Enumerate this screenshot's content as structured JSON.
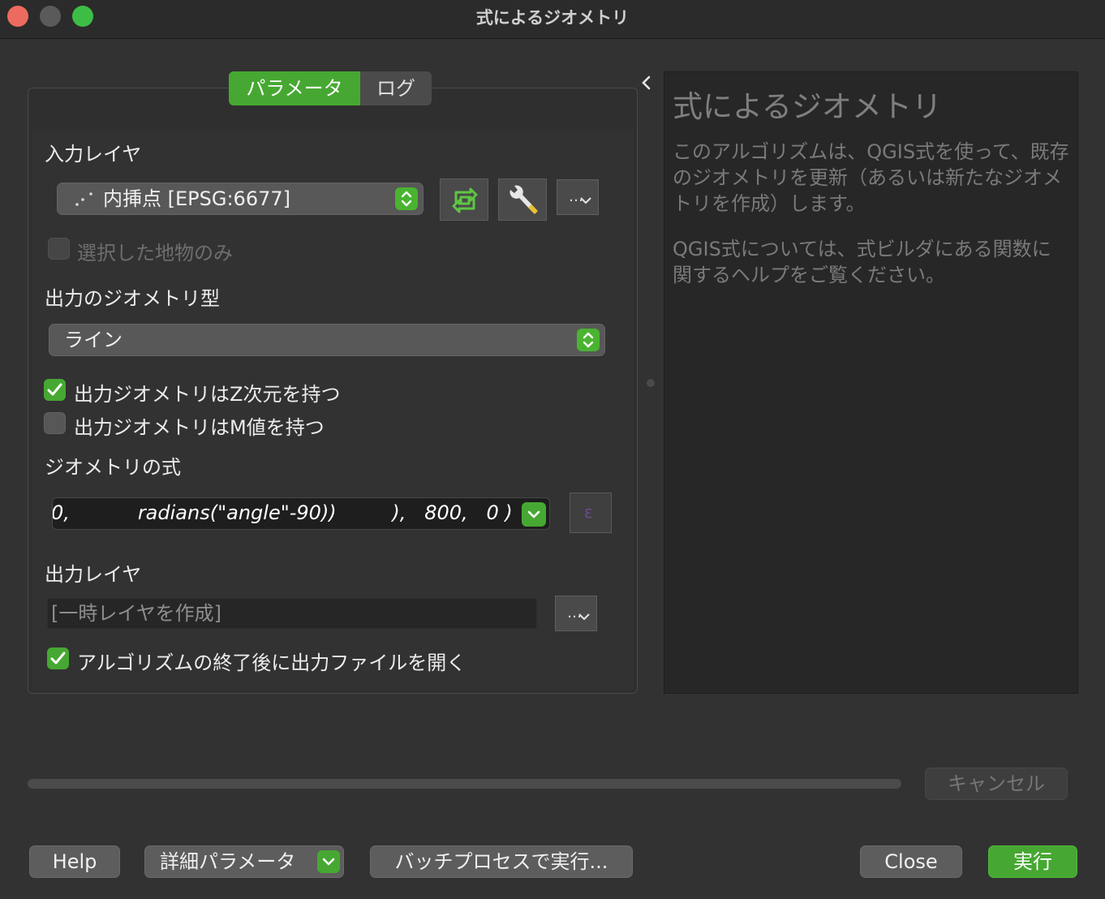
{
  "window": {
    "title": "式によるジオメトリ"
  },
  "tabs": [
    {
      "label": "パラメータ",
      "active": true
    },
    {
      "label": "ログ",
      "active": false
    }
  ],
  "params": {
    "input_layer_label": "入力レイヤ",
    "input_layer_value": "内挿点 [EPSG:6677]",
    "selected_only_label": "選択した地物のみ",
    "selected_only_checked": false,
    "output_geom_type_label": "出力のジオメトリ型",
    "output_geom_type_value": "ライン",
    "has_z_label": "出力ジオメトリはZ次元を持つ",
    "has_z_checked": true,
    "has_m_label": "出力ジオメトリはM値を持つ",
    "has_m_checked": false,
    "expression_label": "ジオメトリの式",
    "expression_value": "0,           radians(\"angle\"-90))         ),   800,   0 )",
    "output_layer_label": "出力レイヤ",
    "output_layer_placeholder": "[一時レイヤを作成]",
    "open_output_label": "アルゴリズムの終了後に出力ファイルを開く",
    "open_output_checked": true,
    "dots_label": "…"
  },
  "help": {
    "title": "式によるジオメトリ",
    "paragraph1": "このアルゴリズムは、QGIS式を使って、既存のジオメトリを更新（あるいは新たなジオメトリを作成）します。",
    "paragraph2": "QGIS式については、式ビルダにある関数に関するヘルプをご覧ください。"
  },
  "progress": {
    "value": 0
  },
  "buttons": {
    "cancel": "キャンセル",
    "help": "Help",
    "advanced": "詳細パラメータ",
    "batch": "バッチプロセスで実行...",
    "close": "Close",
    "run": "実行"
  },
  "colors": {
    "accent": "#46a832",
    "background": "#323232"
  }
}
